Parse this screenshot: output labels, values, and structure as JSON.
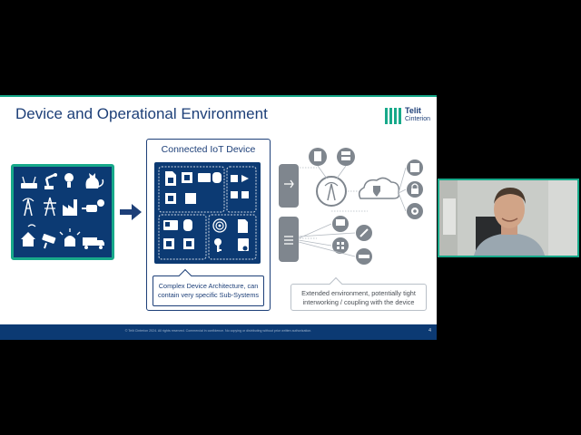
{
  "slide": {
    "title": "Device and Operational Environment",
    "logo": {
      "name_line1": "Telit",
      "name_line2": "Cinterion",
      "color": "#17a98a"
    },
    "left_panel": {
      "icons": [
        "router-icon",
        "robot-arm-icon",
        "lightbulb-icon",
        "cat-icon",
        "satellite-tower-icon",
        "power-pylon-icon",
        "factory-icon",
        "plug-icon",
        "smart-home-icon",
        "camera-icon",
        "alarm-light-icon",
        "truck-icon"
      ]
    },
    "device_card": {
      "title": "Connected IoT Device",
      "caption": "Complex Device Architecture, can contain very specific Sub-Systems",
      "subsystem_icons": [
        "sim-card-icon",
        "cpu-chip-icon",
        "gpu-icon",
        "database-icon",
        "chip-icon",
        "process-flow-icon",
        "id-card-icon",
        "fingerprint-icon",
        "sd-card-icon",
        "database-icon",
        "key-icon",
        "certificate-icon"
      ]
    },
    "environment": {
      "caption": "Extended environment, potentially tight interworking / coupling with the device",
      "icons": [
        "document-icon",
        "server-icon",
        "cell-tower-icon",
        "cloud-shield-icon",
        "storage-icon",
        "lock-icon",
        "gear-icon",
        "monitor-icon",
        "plug-icon",
        "network-icon",
        "router-icon",
        "wireless-icon",
        "serial-port-icon"
      ]
    },
    "footer": {
      "text": "© Telit Cinterion 2024. All rights reserved. Commercial in confidence. No copying or distributing without prior written authorization.",
      "page_number": "4"
    }
  },
  "video": {
    "participant_label": "presenter-video"
  },
  "colors": {
    "navy": "#0c3a73",
    "teal": "#17a98a",
    "title_blue": "#1d3f78",
    "grey_icon": "#7f868e"
  }
}
